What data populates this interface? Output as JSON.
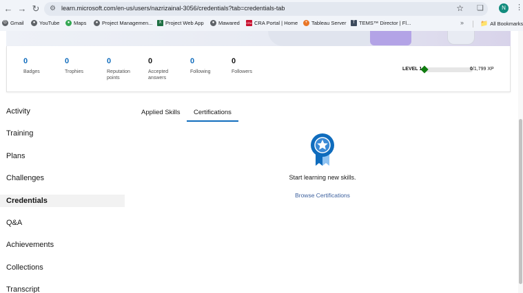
{
  "browser": {
    "url": "learn.microsoft.com/en-us/users/nazrizainal-3056/credentials?tab=credentials-tab",
    "avatar_letter": "N",
    "bookmarks": [
      {
        "label": "Gmail",
        "icon": "google-icon",
        "color": "#5f6368"
      },
      {
        "label": "YouTube",
        "icon": "globe-icon",
        "color": "#5f6368"
      },
      {
        "label": "Maps",
        "icon": "maps-icon",
        "color": "#34a853"
      },
      {
        "label": "Project Managemen...",
        "icon": "globe-icon",
        "color": "#5f6368"
      },
      {
        "label": "Project Web App",
        "icon": "excel-icon",
        "color": "#1d6f42"
      },
      {
        "label": "Mawared",
        "icon": "globe-icon",
        "color": "#5f6368"
      },
      {
        "label": "CRA Portal | Home",
        "icon": "cra-icon",
        "color": "#c8102e"
      },
      {
        "label": "Tableau Server",
        "icon": "tableau-icon",
        "color": "#e97627"
      },
      {
        "label": "TEMS™ Director | Fl...",
        "icon": "tems-icon",
        "color": "#3c4a5c"
      }
    ],
    "all_bookmarks": "All Bookmarks"
  },
  "stats": [
    {
      "value": "0",
      "label": "Badges"
    },
    {
      "value": "0",
      "label": "Trophies"
    },
    {
      "value": "0",
      "label": "Reputation points"
    },
    {
      "value": "0",
      "label": "Accepted answers"
    },
    {
      "value": "0",
      "label": "Following"
    },
    {
      "value": "0",
      "label": "Followers"
    }
  ],
  "level": {
    "label": "LEVEL 1",
    "xp_current": "0",
    "xp_total": "/1,799 XP",
    "progress": 0
  },
  "sidebar": {
    "items": [
      {
        "label": "Activity",
        "active": false
      },
      {
        "label": "Training",
        "active": false
      },
      {
        "label": "Plans",
        "active": false
      },
      {
        "label": "Challenges",
        "active": false
      },
      {
        "label": "Credentials",
        "active": true
      },
      {
        "label": "Q&A",
        "active": false
      },
      {
        "label": "Achievements",
        "active": false
      },
      {
        "label": "Collections",
        "active": false
      },
      {
        "label": "Transcript",
        "active": false
      }
    ]
  },
  "tabs": [
    {
      "label": "Applied Skills",
      "active": false
    },
    {
      "label": "Certifications",
      "active": true
    }
  ],
  "empty_state": {
    "message": "Start learning new skills.",
    "link": "Browse Certifications",
    "icon": "certification-badge-icon",
    "accent": "#0f6cbd"
  }
}
